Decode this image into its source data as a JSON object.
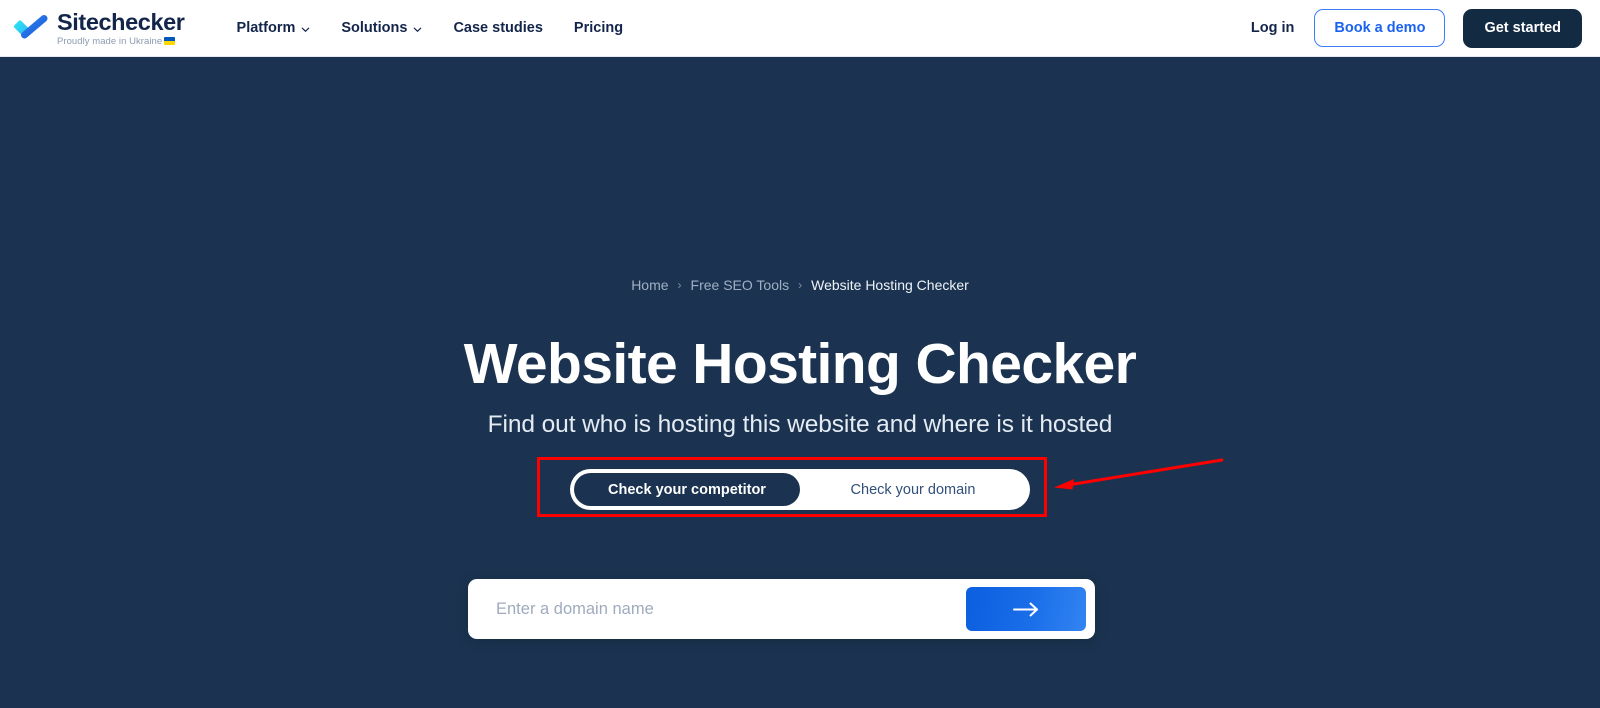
{
  "header": {
    "logo": {
      "icon": "checkmark-logo-icon",
      "name": "Sitechecker",
      "tagline": "Proudly made in Ukraine",
      "flag_icon": "ukraine-flag-icon"
    },
    "nav": [
      {
        "label": "Platform",
        "has_dropdown": true,
        "icon": "chevron-down-icon"
      },
      {
        "label": "Solutions",
        "has_dropdown": true,
        "icon": "chevron-down-icon"
      },
      {
        "label": "Case studies",
        "has_dropdown": false
      },
      {
        "label": "Pricing",
        "has_dropdown": false
      }
    ],
    "login_label": "Log in",
    "demo_label": "Book a demo",
    "get_started_label": "Get started"
  },
  "hero": {
    "breadcrumb": {
      "items": [
        "Home",
        "Free SEO Tools"
      ],
      "separator": "›",
      "current": "Website Hosting Checker"
    },
    "title": "Website Hosting Checker",
    "subtitle": "Find out who is hosting this website and where is it hosted",
    "toggle": {
      "active_label": "Check your competitor",
      "inactive_label": "Check your domain",
      "selected": "Check your competitor"
    },
    "search": {
      "placeholder": "Enter a domain name",
      "value": "",
      "submit_icon": "arrow-right-icon"
    }
  },
  "annotations": {
    "highlight_box": {
      "color": "#ff0000",
      "target": "search-mode-toggle"
    },
    "pointer_arrow": {
      "color": "#ff0000",
      "direction": "left"
    }
  },
  "colors": {
    "hero_background": "#1b3350",
    "header_background": "#ffffff",
    "brand_navy": "#13254a",
    "brand_blue": "#1a63f0",
    "logo_cyan": "#22d3ee",
    "annotation_red": "#ff0000",
    "submit_blue": "#0b5fe0"
  }
}
